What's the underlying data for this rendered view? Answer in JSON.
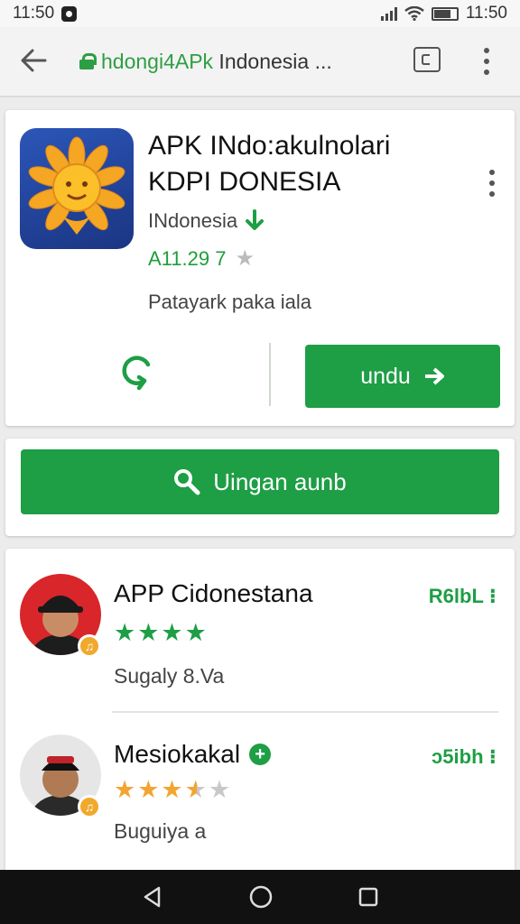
{
  "status_bar": {
    "time": "11:50",
    "clock_right": "11:50"
  },
  "browser": {
    "url_host": "hdongi4APk",
    "url_rest": " Indonesia ..."
  },
  "app": {
    "title_line1": "APK INdo:akulnolari",
    "title_line2": "KDPI DONESIA",
    "developer": "INdonesia",
    "rating_value": "A11.29 7",
    "installs_text": "Patayark paka iala",
    "install_button": "undu",
    "search_button": "Uingan aunb"
  },
  "related": [
    {
      "name": "APP Cidonestana",
      "size": "R6lbL",
      "rating": 4,
      "subtitle": "Sugaly 8.Va",
      "verified": false
    },
    {
      "name": "Mesiokakal",
      "size": "ɔ5ibh",
      "rating": 3.5,
      "subtitle": "Buguiya a",
      "verified": true
    }
  ],
  "colors": {
    "accent": "#1e9e45",
    "star_orange": "#f2a531"
  }
}
